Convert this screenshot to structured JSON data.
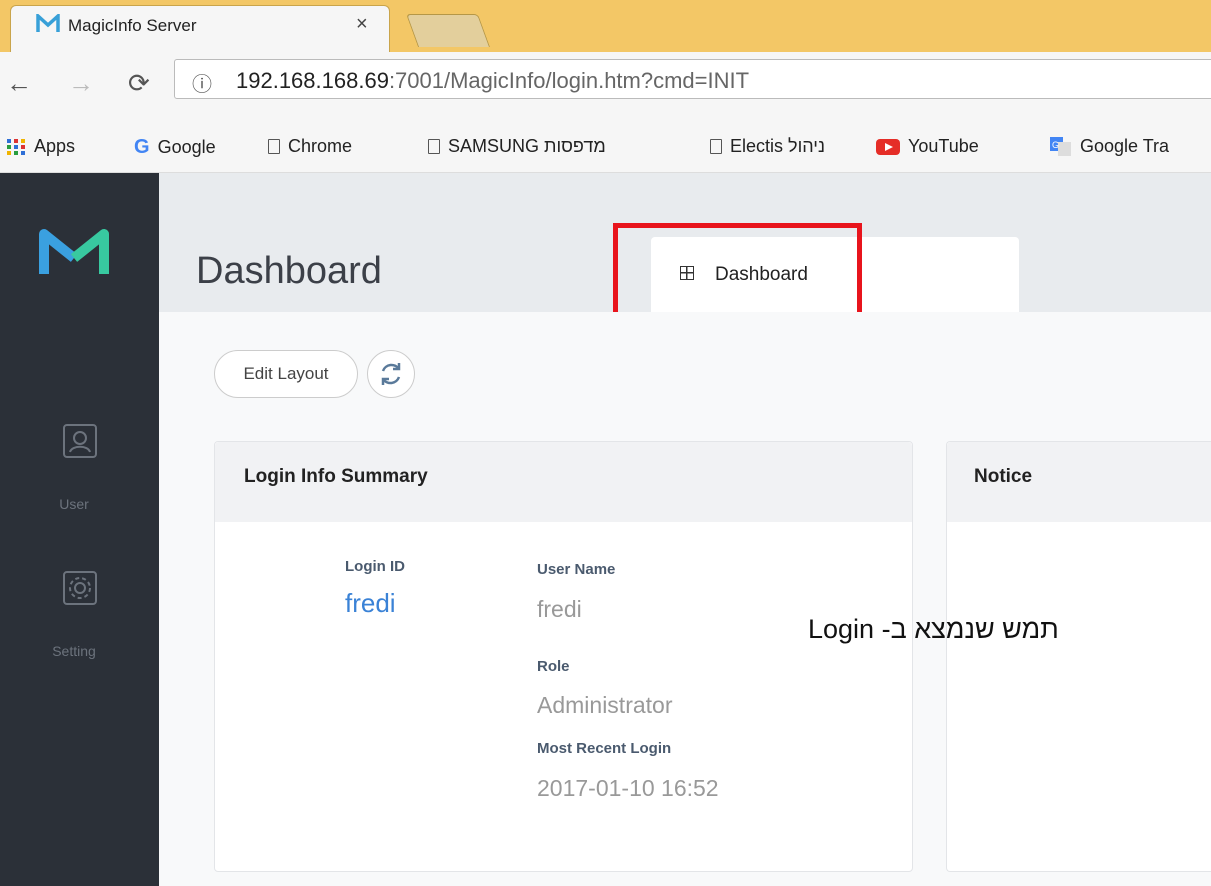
{
  "browser": {
    "tab_title": "MagicInfo Server",
    "tab_close": "×",
    "url_host": "192.168.168.69",
    "url_rest": ":7001/MagicInfo/login.htm?cmd=INIT",
    "info_icon": "ⓘ",
    "bookmarks": [
      {
        "label": "Apps",
        "icon": "apps-grid-icon"
      },
      {
        "label": "Google",
        "icon": "google-g-icon"
      },
      {
        "label": "Chrome",
        "icon": "page-icon"
      },
      {
        "label": "SAMSUNG מדפסות",
        "icon": "page-icon"
      },
      {
        "label": "Electis ניהול",
        "icon": "page-icon"
      },
      {
        "label": "YouTube",
        "icon": "youtube-icon"
      },
      {
        "label": "Google Tra",
        "icon": "google-translate-icon"
      }
    ]
  },
  "sidebar": {
    "items": [
      {
        "label": "User",
        "icon": "user-icon"
      },
      {
        "label": "Setting",
        "icon": "gear-icon"
      }
    ]
  },
  "header": {
    "title": "Dashboard",
    "tab_label": "Dashboard"
  },
  "toolbar": {
    "edit_layout": "Edit Layout"
  },
  "login_card": {
    "title": "Login Info Summary",
    "login_id_label": "Login ID",
    "login_id_value": "fredi",
    "user_name_label": "User Name",
    "user_name_value": "fredi",
    "role_label": "Role",
    "role_value": "Administrator",
    "recent_login_label": "Most Recent Login",
    "recent_login_value": "2017-01-10 16:52"
  },
  "notice_card": {
    "title": "Notice"
  },
  "annotation": {
    "text": "תמש שנמצא ב- Login"
  },
  "colors": {
    "highlight": "#e8141c",
    "sidebar": "#2b3038",
    "accent_blue": "#3a82d6",
    "logo_blue": "#3aa0e0",
    "logo_green": "#38c9a0"
  }
}
